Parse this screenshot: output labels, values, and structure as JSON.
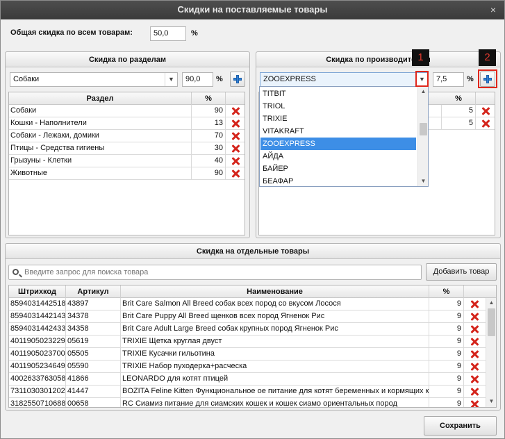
{
  "window": {
    "title": "Скидки на поставляемые товары",
    "close_glyph": "×"
  },
  "overall": {
    "label": "Общая скидка по всем товарам:",
    "value": "50,0",
    "unit": "%"
  },
  "sections_panel": {
    "title": "Скидка по разделам",
    "selected": "Собаки",
    "value": "90,0",
    "unit": "%",
    "columns": [
      "Раздел",
      "%"
    ],
    "rows": [
      {
        "name": "Собаки",
        "pct": "90"
      },
      {
        "name": "Кошки - Наполнители",
        "pct": "13"
      },
      {
        "name": "Собаки - Лежаки, домики",
        "pct": "70"
      },
      {
        "name": "Птицы - Средства гигиены",
        "pct": "30"
      },
      {
        "name": "Грызуны - Клетки",
        "pct": "40"
      },
      {
        "name": "Животные",
        "pct": "90"
      }
    ]
  },
  "makers_panel": {
    "title": "Скидка по производителям",
    "selected": "ZOOEXPRESS",
    "value": "7,5",
    "unit": "%",
    "pct_header": "%",
    "rows": [
      {
        "pct": "5"
      },
      {
        "pct": "5"
      }
    ],
    "dropdown_options": [
      "TITBIT",
      "TRIOL",
      "TRIXIE",
      "VITAKRAFT",
      "ZOOEXPRESS",
      "АЙДА",
      "БАЙЕР",
      "БЕАФАР"
    ],
    "dropdown_selected_index": 4
  },
  "annotations": {
    "badge1": "1",
    "badge2": "2",
    "highlight_color": "#e0261b"
  },
  "products_panel": {
    "title": "Скидка на отдельные товары",
    "search_placeholder": "Введите запрос для поиска товара",
    "add_button": "Добавить товар",
    "columns": [
      "Штрихкод",
      "Артикул",
      "Наименование",
      "%"
    ],
    "rows": [
      {
        "barcode": "8594031442518",
        "article": "43897",
        "name": "Brit Care Salmon All Breed собак всех пород со вкусом Лосося",
        "pct": "9"
      },
      {
        "barcode": "8594031442143",
        "article": "34378",
        "name": "Brit Care Puppy All Breed щенков всех пород Ягненок Рис",
        "pct": "9"
      },
      {
        "barcode": "8594031442433",
        "article": "34358",
        "name": "Brit Care Adult Large Breed собак крупных пород Ягненок Рис",
        "pct": "9"
      },
      {
        "barcode": "4011905023229",
        "article": "05619",
        "name": "TRIXIE Щетка круглая двуст",
        "pct": "9"
      },
      {
        "barcode": "4011905023700",
        "article": "05505",
        "name": "TRIXIE Кусачки гильотина",
        "pct": "9"
      },
      {
        "barcode": "4011905234649",
        "article": "05590",
        "name": "TRIXIE Набор пуходерка+расческа",
        "pct": "9"
      },
      {
        "barcode": "4002633763058",
        "article": "41866",
        "name": "LEONARDO для котят птицей",
        "pct": "9"
      },
      {
        "barcode": "7311030301202",
        "article": "41447",
        "name": "BOZITA Feline Kitten Функциональное ое питание для котят беременных и кормящих к",
        "pct": "9"
      },
      {
        "barcode": "3182550710688",
        "article": "00658",
        "name": "RC Сиамиз питание для сиамских кошек и кошек сиамо ориентальных пород",
        "pct": "9"
      }
    ]
  },
  "footer": {
    "save_button": "Сохранить"
  }
}
